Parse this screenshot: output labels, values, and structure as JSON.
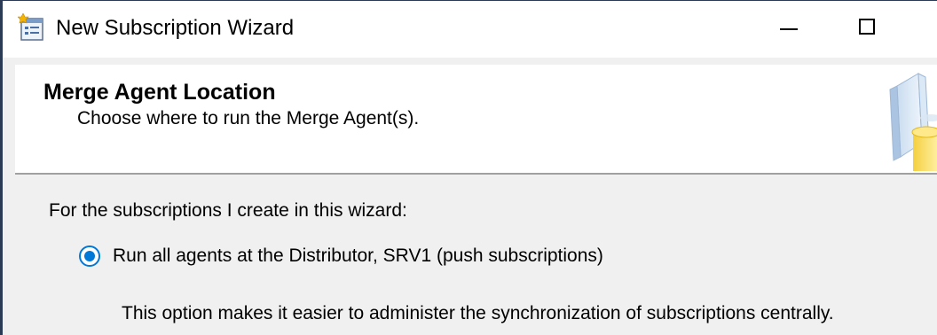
{
  "window": {
    "title": "New Subscription Wizard",
    "icon": "wizard-app-icon"
  },
  "title_bar_buttons": {
    "minimize_icon": "minimize-icon",
    "maximize_icon": "maximize-icon"
  },
  "header": {
    "title": "Merge Agent Location",
    "subtitle": "Choose where to run the Merge Agent(s).",
    "art_icon": "database-books-icon"
  },
  "body": {
    "section_label": "For the subscriptions I create in this wizard:",
    "options": [
      {
        "label": "Run all agents at the Distributor, SRV1 (push subscriptions)",
        "selected": true,
        "description": "This option makes it easier to administer the synchronization of subscriptions centrally."
      }
    ]
  },
  "colors": {
    "accent": "#0078d7",
    "window_border": "#2b3a55",
    "panel_bg": "#ffffff",
    "dialog_bg": "#f0f0f0",
    "separator": "#a0a0a0"
  }
}
